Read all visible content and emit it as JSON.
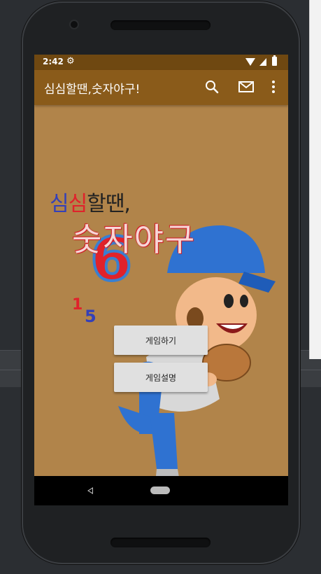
{
  "status_bar": {
    "time": "2:42",
    "settings_icon": "gear-icon",
    "wifi_icon": "wifi-icon",
    "signal_icon": "signal-icon",
    "battery_icon": "battery-icon"
  },
  "app_bar": {
    "title": "심심할땐,숫자야구!",
    "actions": [
      {
        "icon": "search-icon"
      },
      {
        "icon": "mail-icon"
      },
      {
        "icon": "more-vert-icon"
      }
    ]
  },
  "hero": {
    "logo_line1": [
      "심",
      "심",
      "할땐,"
    ],
    "logo_line2": "숫자야구",
    "badge_number": "6",
    "small_numbers": [
      "1",
      "5"
    ]
  },
  "buttons": {
    "play_label": "게임하기",
    "help_label": "게임설명"
  },
  "navigation_bar": {
    "back_icon": "back-icon",
    "home_icon": "home-icon"
  },
  "colors": {
    "status_bar": "#6f4811",
    "app_bar": "#8a5b1a",
    "background": "#b1844a",
    "button": "#e0e0e0"
  }
}
